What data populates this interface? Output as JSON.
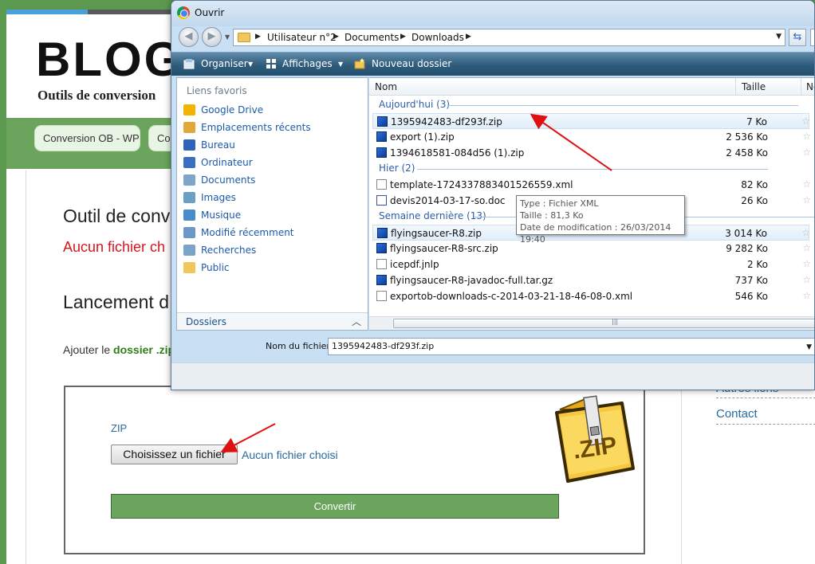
{
  "blog": {
    "title": "BLOG",
    "subtitle": "Outils de conversion",
    "nav": [
      "Conversion OB - WP",
      "Co"
    ],
    "tool_heading": "Outil de conv",
    "error_text": "Aucun fichier ch",
    "launch_heading": "Lancement d",
    "add_prefix": "Ajouter le ",
    "add_bold": "dossier .zip",
    "zip_label": "ZIP",
    "choose_button": "Choisissez un fichier",
    "no_file_text": "Aucun fichier choisi",
    "convert_button": "Convertir",
    "zip_art_text": ".ZIP",
    "sidebar_links": [
      "Autres liens",
      "Contact"
    ]
  },
  "dialog": {
    "title": "Ouvrir",
    "breadcrumb": [
      "Utilisateur n°2",
      "Documents",
      "Downloads"
    ],
    "toolbar": {
      "organize": "Organiser",
      "views": "Affichages",
      "new_folder": "Nouveau dossier"
    },
    "nav_header": "Liens favoris",
    "nav_items": [
      {
        "label": "Google Drive",
        "icon": "google-drive-icon",
        "color": "#f2b400"
      },
      {
        "label": "Emplacements récents",
        "icon": "recent-places-icon",
        "color": "#e0a93a"
      },
      {
        "label": "Bureau",
        "icon": "desktop-icon",
        "color": "#2f63b8"
      },
      {
        "label": "Ordinateur",
        "icon": "computer-icon",
        "color": "#3a6fc2"
      },
      {
        "label": "Documents",
        "icon": "documents-icon",
        "color": "#7ea6c9"
      },
      {
        "label": "Images",
        "icon": "images-icon",
        "color": "#6aa0c4"
      },
      {
        "label": "Musique",
        "icon": "music-icon",
        "color": "#4b8ac8"
      },
      {
        "label": "Modifié récemment",
        "icon": "recently-modified-icon",
        "color": "#6b97c9"
      },
      {
        "label": "Recherches",
        "icon": "searches-icon",
        "color": "#7aa3c8"
      },
      {
        "label": "Public",
        "icon": "public-folder-icon",
        "color": "#f1c65a"
      }
    ],
    "folders_label": "Dossiers",
    "columns": {
      "name": "Nom",
      "size": "Taille",
      "extra": "No"
    },
    "groups": [
      {
        "label": "Aujourd'hui (3)",
        "files": [
          {
            "name": "1395942483-df293f.zip",
            "size": "7 Ko",
            "type": "zip",
            "selected": true
          },
          {
            "name": "export (1).zip",
            "size": "2 536 Ko",
            "type": "zip"
          },
          {
            "name": "1394618581-084d56 (1).zip",
            "size": "2 458 Ko",
            "type": "zip"
          }
        ]
      },
      {
        "label": "Hier (2)",
        "files": [
          {
            "name": "template-1724337883401526559.xml",
            "size": "82 Ko",
            "type": "xml"
          },
          {
            "name": "devis2014-03-17-so.doc",
            "size": "26 Ko",
            "type": "doc"
          }
        ]
      },
      {
        "label": "Semaine dernière (13)",
        "files": [
          {
            "name": "flyingsaucer-R8.zip",
            "size": "3 014 Ko",
            "type": "zip",
            "hover": true
          },
          {
            "name": "flyingsaucer-R8-src.zip",
            "size": "9 282 Ko",
            "type": "zip"
          },
          {
            "name": "icepdf.jnlp",
            "size": "2 Ko",
            "type": "jnlp"
          },
          {
            "name": "flyingsaucer-R8-javadoc-full.tar.gz",
            "size": "737 Ko",
            "type": "zip"
          },
          {
            "name": "exportob-downloads-c-2014-03-21-18-46-08-0.xml",
            "size": "546 Ko",
            "type": "xml"
          }
        ]
      }
    ],
    "tooltip": {
      "type": "Type : Fichier XML",
      "size": "Taille : 81,3 Ko",
      "date": "Date de modification : 26/03/2014 19:40"
    },
    "filename_label": "Nom du fichier :",
    "filename_value": "1395942483-df293f.zip"
  }
}
